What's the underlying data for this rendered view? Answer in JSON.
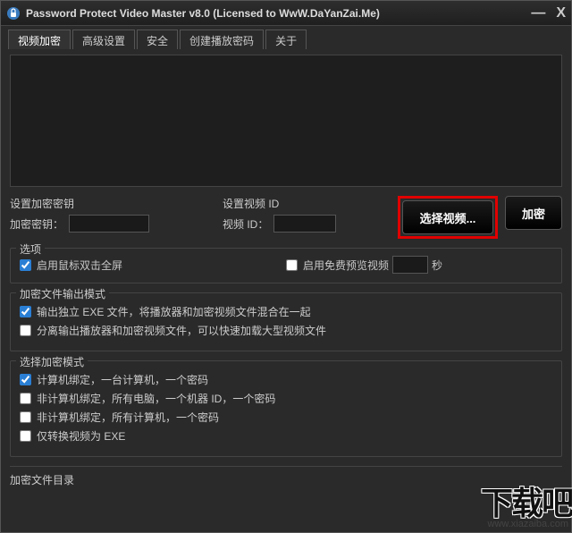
{
  "titlebar": {
    "title": "Password Protect Video Master v8.0 (Licensed to WwW.DaYanZai.Me)"
  },
  "tabs": [
    "视频加密",
    "高级设置",
    "安全",
    "创建播放密码",
    "关于"
  ],
  "activeTab": 0,
  "key_section": {
    "header": "设置加密密钥",
    "label": "加密密钥：",
    "value": ""
  },
  "id_section": {
    "header": "设置视频 ID",
    "label": "视频 ID：",
    "value": ""
  },
  "buttons": {
    "select": "选择视频...",
    "encrypt": "加密"
  },
  "options": {
    "legend": "选项",
    "dblclick": "启用鼠标双击全屏",
    "freepreview": "启用免费预览视频",
    "seconds_value": "",
    "seconds_unit": "秒"
  },
  "output_mode": {
    "legend": "加密文件输出模式",
    "opt1": "输出独立 EXE 文件，将播放器和加密视频文件混合在一起",
    "opt2": "分离输出播放器和加密视频文件，可以快速加载大型视频文件"
  },
  "encrypt_mode": {
    "legend": "选择加密模式",
    "opt1": "计算机绑定，一台计算机，一个密码",
    "opt2": "非计算机绑定，所有电脑，一个机器 ID，一个密码",
    "opt3": "非计算机绑定，所有计算机，一个密码",
    "opt4": "仅转换视频为 EXE"
  },
  "output_dir": {
    "label": "加密文件目录"
  },
  "watermark": {
    "big": "下载吧",
    "small": "www.xiazaiba.com"
  }
}
